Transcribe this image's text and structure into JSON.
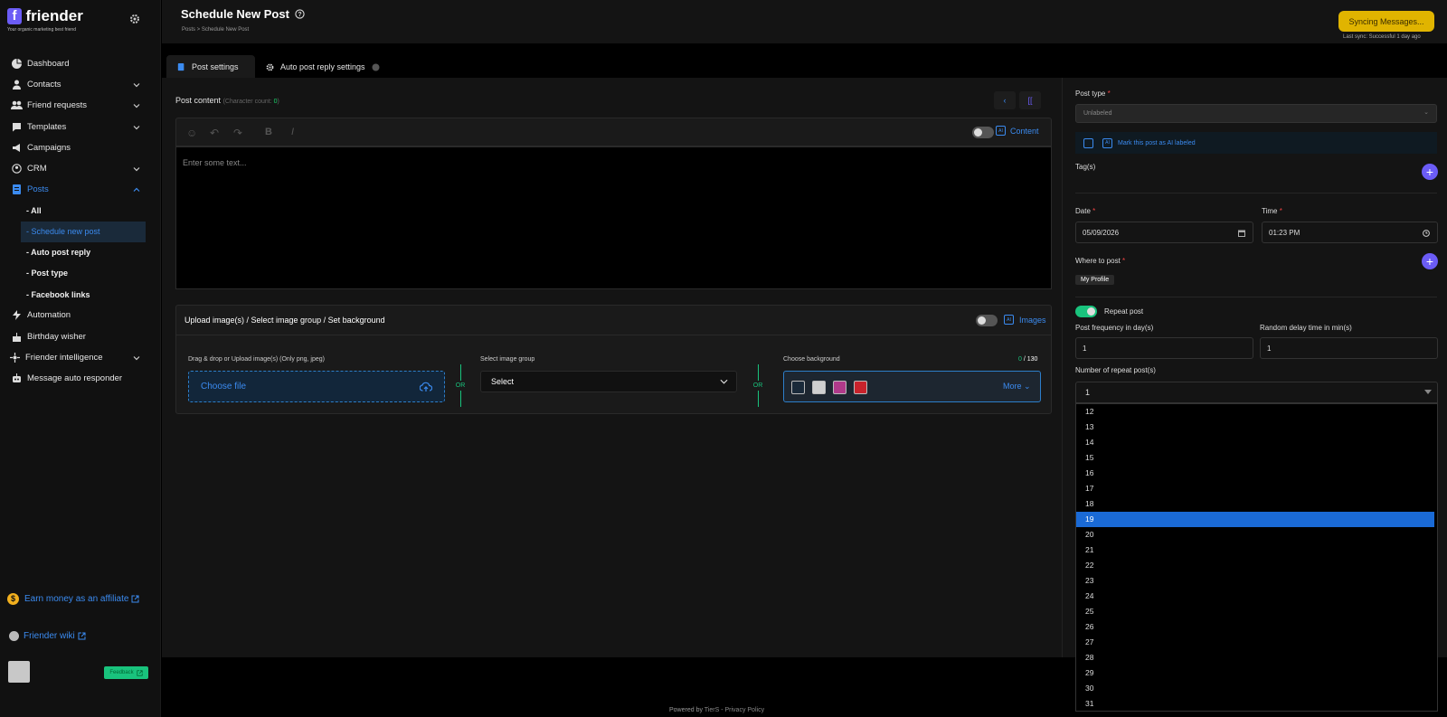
{
  "brand": {
    "name": "friender",
    "tagline": "Your organic marketing best friend"
  },
  "sidebar": {
    "items": [
      {
        "label": "Dashboard",
        "icon": "dashboard-icon",
        "chevron": false
      },
      {
        "label": "Contacts",
        "icon": "contacts-icon",
        "chevron": true
      },
      {
        "label": "Friend requests",
        "icon": "friend-requests-icon",
        "chevron": true
      },
      {
        "label": "Templates",
        "icon": "templates-icon",
        "chevron": true
      },
      {
        "label": "Campaigns",
        "icon": "megaphone-icon",
        "chevron": false
      },
      {
        "label": "CRM",
        "icon": "crm-icon",
        "chevron": true
      },
      {
        "label": "Posts",
        "icon": "posts-icon",
        "chevron": true,
        "active": true
      }
    ],
    "posts_sub": [
      "- All",
      "- Schedule new post",
      "- Auto post reply",
      "- Post type",
      "- Facebook links"
    ],
    "items_after": [
      {
        "label": "Automation",
        "icon": "lightning-icon"
      },
      {
        "label": "Birthday wisher",
        "icon": "cake-icon"
      },
      {
        "label": "Friender intelligence",
        "icon": "intelligence-icon"
      },
      {
        "label": "Message auto responder",
        "icon": "robot-icon"
      }
    ],
    "affiliate": "Earn money as an affiliate",
    "wiki": "Friender wiki",
    "feedback": "Feedback"
  },
  "header": {
    "title": "Schedule New Post",
    "breadcrumb": "Posts  >  Schedule New Post",
    "sync_button": "Syncing Messages...",
    "sync_status": "Last sync: Successful 1 day ago"
  },
  "tabs": {
    "post_settings": "Post settings",
    "auto_reply": "Auto post reply settings"
  },
  "editor": {
    "label": "Post content",
    "char_count_label": "(Character count: ",
    "char_count": "0",
    "char_count_close": ")",
    "placeholder": "Enter some text...",
    "content_link": "Content"
  },
  "upload": {
    "heading": "Upload image(s) / Select image group / Set background",
    "images_link": "Images",
    "drag_label": "Drag & drop or Upload image(s) (Only png, jpeg)",
    "choose_file": "Choose file",
    "or": "OR",
    "group_label": "Select image group",
    "group_value": "Select",
    "bg_label": "Choose background",
    "bg_count_used": "0",
    "bg_count_total": " / 130",
    "more": "More",
    "swatch_colors": [
      "#1a2a3a",
      "#cfcfcf",
      "#b03a8a",
      "#c8232c"
    ]
  },
  "right": {
    "post_type_label": "Post type",
    "post_type_value": "Unlabeled",
    "ai_label": "Mark this post as AI labeled",
    "tags_label": "Tag(s)",
    "date_label": "Date",
    "date_value": "05/09/2026",
    "time_label": "Time",
    "time_value": "01:23 PM",
    "where_label": "Where to post",
    "where_value": "My Profile",
    "repeat_label": "Repeat post",
    "freq_label": "Post frequency in day(s)",
    "freq_value": "1",
    "delay_label": "Random delay time in min(s)",
    "delay_value": "1",
    "num_repeat_label": "Number of repeat post(s)",
    "num_repeat_value": "1",
    "options": [
      "12",
      "13",
      "14",
      "15",
      "16",
      "17",
      "18",
      "19",
      "20",
      "21",
      "22",
      "23",
      "24",
      "25",
      "26",
      "27",
      "28",
      "29",
      "30",
      "31"
    ],
    "highlighted": "19"
  },
  "footer": {
    "prefix": "Powered by ",
    "brand": "TierS",
    "sep": " - ",
    "privacy": "Privacy Policy"
  },
  "colors": {
    "accent": "#3b8bf0",
    "brand": "#6b5cf6",
    "success": "#19c37d",
    "sync": "#e0b400"
  }
}
